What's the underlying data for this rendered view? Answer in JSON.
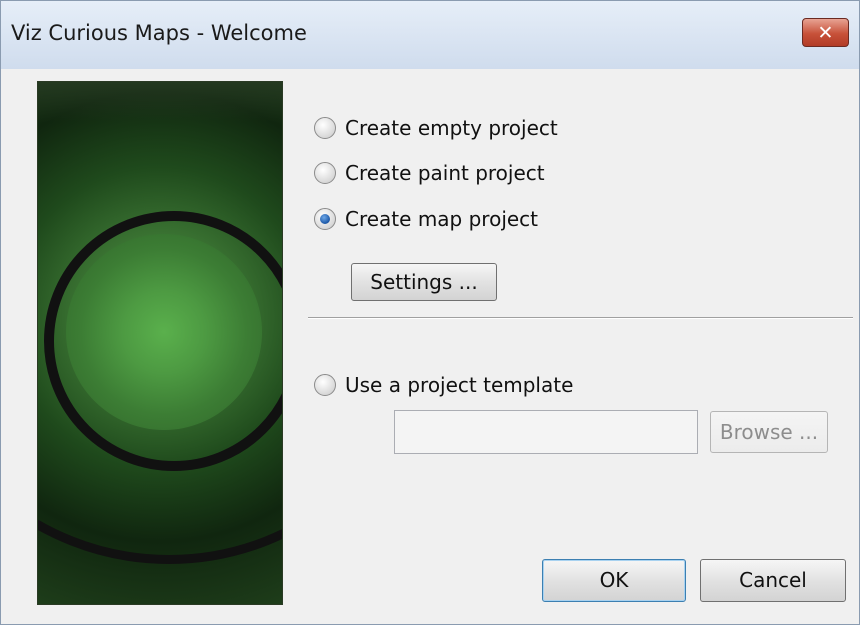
{
  "window": {
    "title": "Viz Curious Maps - Welcome",
    "close_label": "✕"
  },
  "banner": {
    "image": "green concentric rings graphic"
  },
  "options": [
    {
      "label": "Create empty project",
      "checked": false
    },
    {
      "label": "Create paint project",
      "checked": false
    },
    {
      "label": "Create map project",
      "checked": true
    }
  ],
  "settings_button": "Settings ...",
  "template": {
    "label": "Use a project template",
    "checked": false,
    "path_value": "",
    "browse_label": "Browse ..."
  },
  "buttons": {
    "ok": "OK",
    "cancel": "Cancel"
  },
  "colors": {
    "accent": "#1a56a6",
    "close": "#c75139",
    "banner_green": "#4d9a42"
  }
}
